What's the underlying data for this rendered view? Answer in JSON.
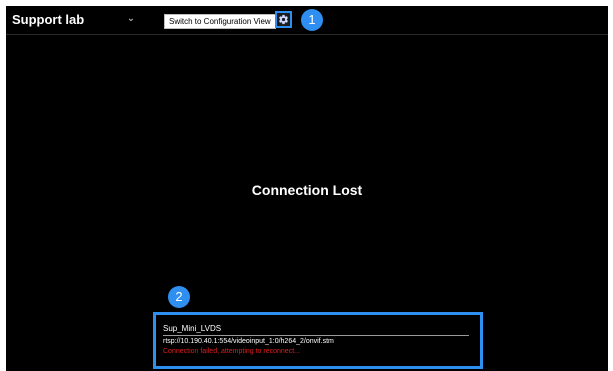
{
  "topbar": {
    "view_title": "Support lab",
    "dropdown_glyph": "⌄",
    "switch_label": "Switch to Configuration View",
    "gear_icon": "gear-icon"
  },
  "markers": {
    "one": "1",
    "two": "2"
  },
  "main": {
    "status": "Connection Lost"
  },
  "camera": {
    "name": "Sup_Mini_LVDS",
    "url": "rtsp://10.190.40.1:554/videoinput_1:0/h264_2/onvif.stm",
    "error": "Connection failed, attempting to reconnect..."
  },
  "colors": {
    "accent": "#2e8ff0",
    "error": "#e01e1e",
    "background": "#000000"
  }
}
